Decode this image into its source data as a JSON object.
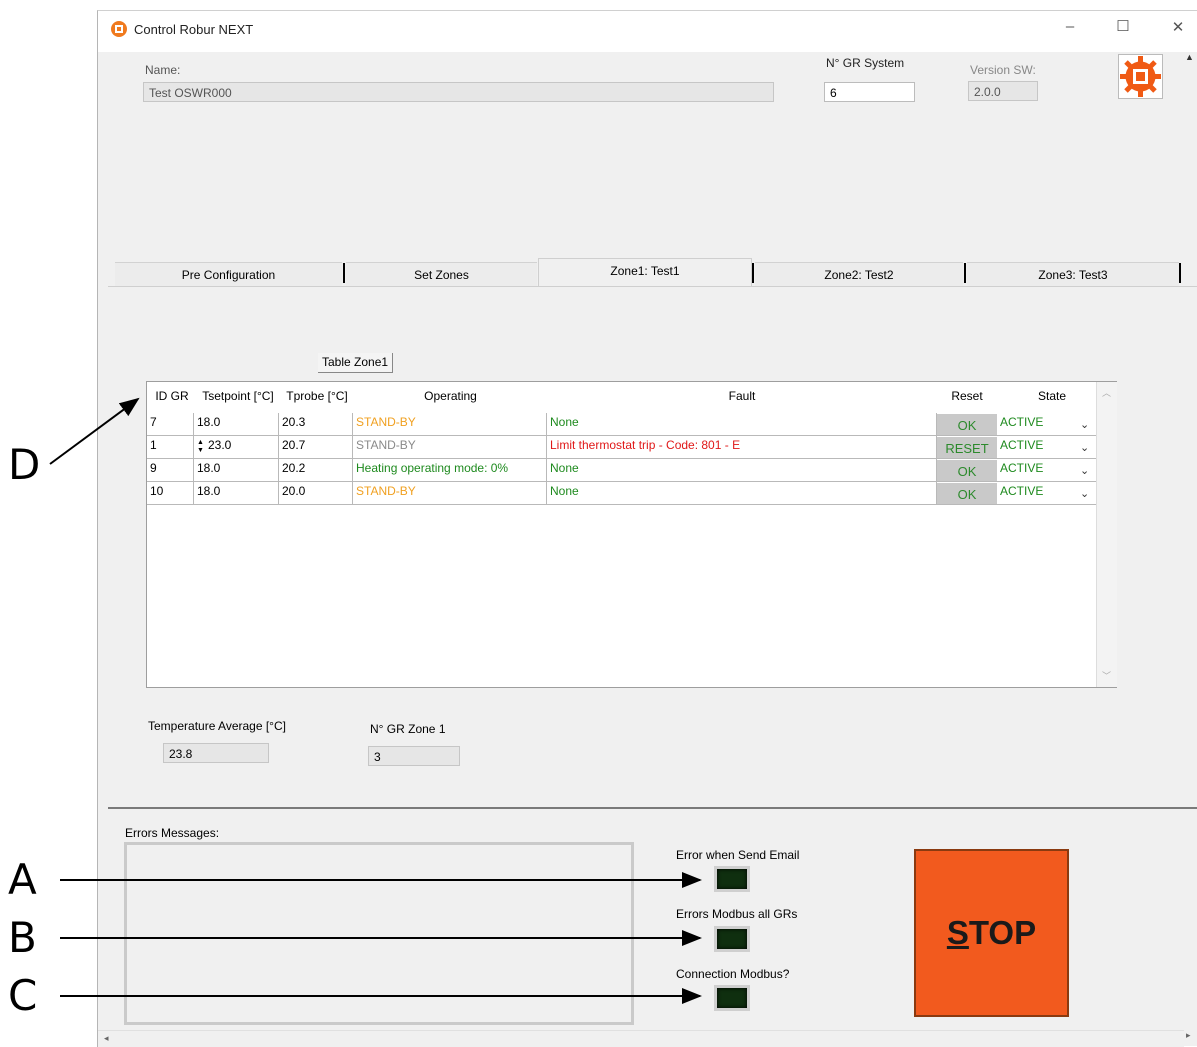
{
  "window": {
    "title": "Control Robur NEXT"
  },
  "header": {
    "name_label": "Name:",
    "name_value": "Test OSWR000",
    "ngr_label": "N° GR System",
    "ngr_value": "6",
    "version_label": "Version SW:",
    "version_value": "2.0.0"
  },
  "tabs": [
    "Pre Configuration",
    "Set Zones",
    "Zone1: Test1",
    "Zone2: Test2",
    "Zone3: Test3"
  ],
  "table": {
    "caption": "Table Zone1",
    "headers": [
      "ID GR",
      "Tsetpoint [°C]",
      "Tprobe [°C]",
      "Operating",
      "Fault",
      "Reset",
      "State"
    ],
    "rows": [
      {
        "id": "7",
        "tset": "18.0",
        "tprobe": "20.3",
        "operating": "STAND-BY",
        "fault": "None",
        "reset": "OK",
        "state": "ACTIVE"
      },
      {
        "id": "1",
        "tset": "23.0",
        "tprobe": "20.7",
        "operating": "STAND-BY",
        "fault": "Limit thermostat trip - Code: 801 - E",
        "reset": "RESET",
        "state": "ACTIVE"
      },
      {
        "id": "9",
        "tset": "18.0",
        "tprobe": "20.2",
        "operating": "Heating operating mode: 0%",
        "fault": "None",
        "reset": "OK",
        "state": "ACTIVE"
      },
      {
        "id": "10",
        "tset": "18.0",
        "tprobe": "20.0",
        "operating": "STAND-BY",
        "fault": "None",
        "reset": "OK",
        "state": "ACTIVE"
      }
    ]
  },
  "summary": {
    "temp_avg_label": "Temperature Average [°C]",
    "temp_avg_value": "23.8",
    "ngr_zone_label": "N° GR Zone 1",
    "ngr_zone_value": "3"
  },
  "errors": {
    "label": "Errors Messages:",
    "email_label": "Error when Send Email",
    "modbus_all_label": "Errors Modbus all GRs",
    "conn_label": "Connection Modbus?"
  },
  "stop_button": {
    "prefix": "S",
    "rest": "TOP"
  },
  "callouts": {
    "a": "A",
    "b": "B",
    "c": "C",
    "d": "D"
  },
  "colors": {
    "standby": "#f0a020",
    "standby_gray": "#8a8a8a",
    "green": "#1e8a1e",
    "red": "#e01818",
    "stop": "#f25a1e"
  }
}
